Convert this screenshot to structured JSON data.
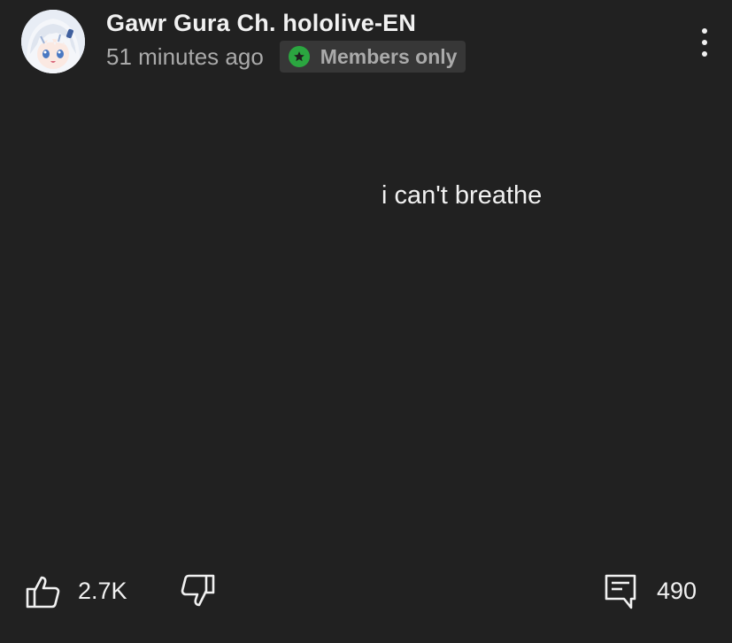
{
  "post": {
    "channel_name": "Gawr Gura Ch. hololive-EN",
    "time_ago": "51 minutes ago",
    "badge": {
      "label": "Members only",
      "icon": "star-icon",
      "color": "#2ba640"
    },
    "text": "i can't breathe",
    "more_icon": "more-vert-icon"
  },
  "actions": {
    "like_icon": "thumbs-up-icon",
    "like_count": "2.7K",
    "dislike_icon": "thumbs-down-icon",
    "comment_icon": "comment-icon",
    "comment_count": "490"
  },
  "colors": {
    "background": "#212121",
    "text_primary": "#f1f1f1",
    "text_secondary": "#aaaaaa",
    "badge_bg": "#373737"
  }
}
